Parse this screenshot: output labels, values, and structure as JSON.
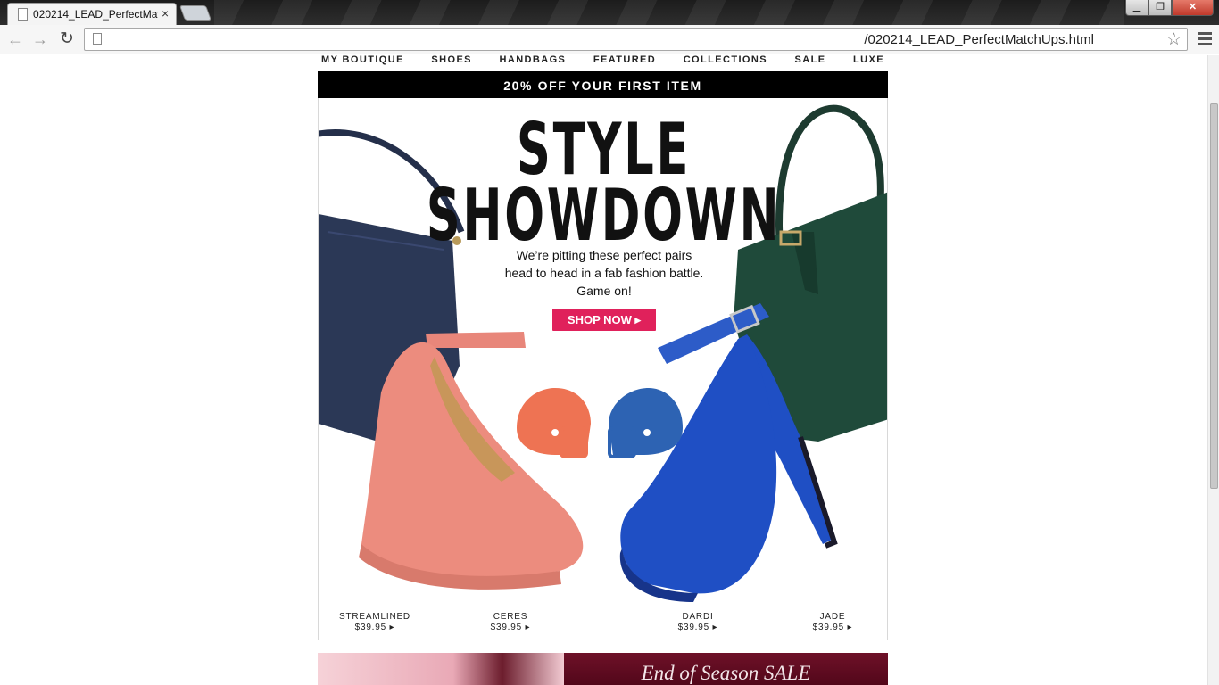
{
  "browser": {
    "tab_title": "020214_LEAD_PerfectMatc",
    "tab_close": "×",
    "url": "/020214_LEAD_PerfectMatchUps.html",
    "controls": {
      "minimize": "▁",
      "maximize": "❐",
      "close": "✕"
    }
  },
  "nav": {
    "items": [
      "MY BOUTIQUE",
      "SHOES",
      "HANDBAGS",
      "FEATURED",
      "COLLECTIONS",
      "SALE",
      "LUXE"
    ]
  },
  "promo": {
    "text": "20% OFF YOUR FIRST ITEM"
  },
  "hero": {
    "headline_line1": "STYLE",
    "headline_line2": "SHOWDOWN",
    "intro_line1": "We’re pitting these perfect pairs",
    "intro_line2": "head to head in a fab fashion battle.",
    "intro_line3": "Game on!",
    "cta": "SHOP NOW ▸"
  },
  "products": [
    {
      "name": "STREAMLINED",
      "price": "$39.95 ▸"
    },
    {
      "name": "CERES",
      "price": "$39.95 ▸"
    },
    {
      "name": "DARDI",
      "price": "$39.95 ▸"
    },
    {
      "name": "JADE",
      "price": "$39.95 ▸"
    }
  ],
  "next_banner": {
    "text": "End of Season SALE"
  },
  "colors": {
    "accent_pink": "#e0215b",
    "helmet_coral": "#ee7353",
    "helmet_blue": "#2d63b3",
    "navy_bag": "#2b3856",
    "green_bag": "#1f4a3a",
    "coral_shoe": "#ec8c7e",
    "blue_shoe": "#1f4fc4"
  }
}
